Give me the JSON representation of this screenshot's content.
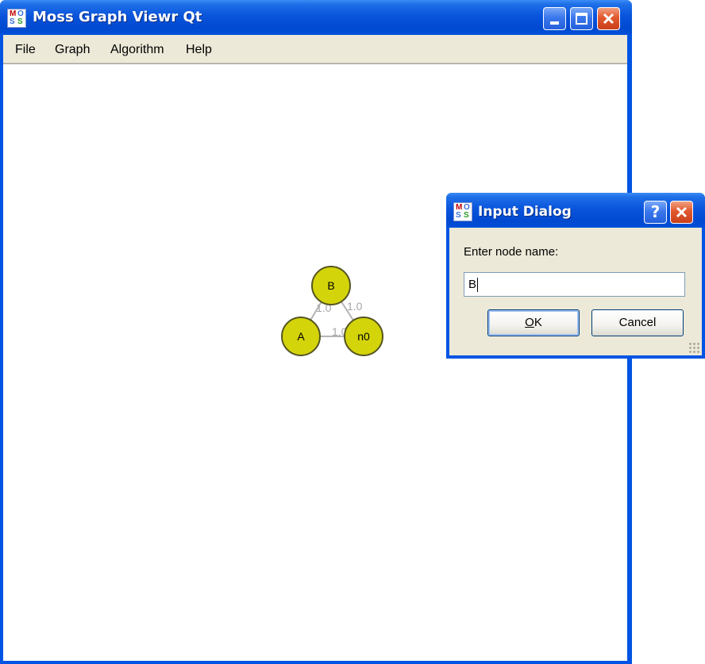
{
  "window": {
    "title": "Moss Graph Viewr Qt",
    "icon": "moss-app-icon",
    "controls": [
      "minimize-icon",
      "maximize-icon",
      "close-icon"
    ]
  },
  "menu": {
    "items": [
      {
        "label": "File"
      },
      {
        "label": "Graph"
      },
      {
        "label": "Algorithm"
      },
      {
        "label": "Help"
      }
    ]
  },
  "graph": {
    "nodes": [
      {
        "id": "B",
        "label": "B"
      },
      {
        "id": "A",
        "label": "A"
      },
      {
        "id": "n0",
        "label": "n0"
      }
    ],
    "edges": [
      {
        "from": "A",
        "to": "B",
        "weight": "1.0"
      },
      {
        "from": "B",
        "to": "n0",
        "weight": "1.0"
      },
      {
        "from": "A",
        "to": "n0",
        "weight": "1.0"
      }
    ],
    "node_color": "#d4d40a",
    "edge_color": "#b4b4b4"
  },
  "dialog": {
    "title": "Input Dialog",
    "prompt": "Enter node name:",
    "input_value": "B",
    "ok_label_underlined": "O",
    "ok_label_rest": "K",
    "cancel_label": "Cancel",
    "controls": [
      "help-icon",
      "close-icon"
    ]
  },
  "colors": {
    "titlebar": "#0054e3",
    "close_button": "#e2582e",
    "face": "#ece9d8"
  }
}
